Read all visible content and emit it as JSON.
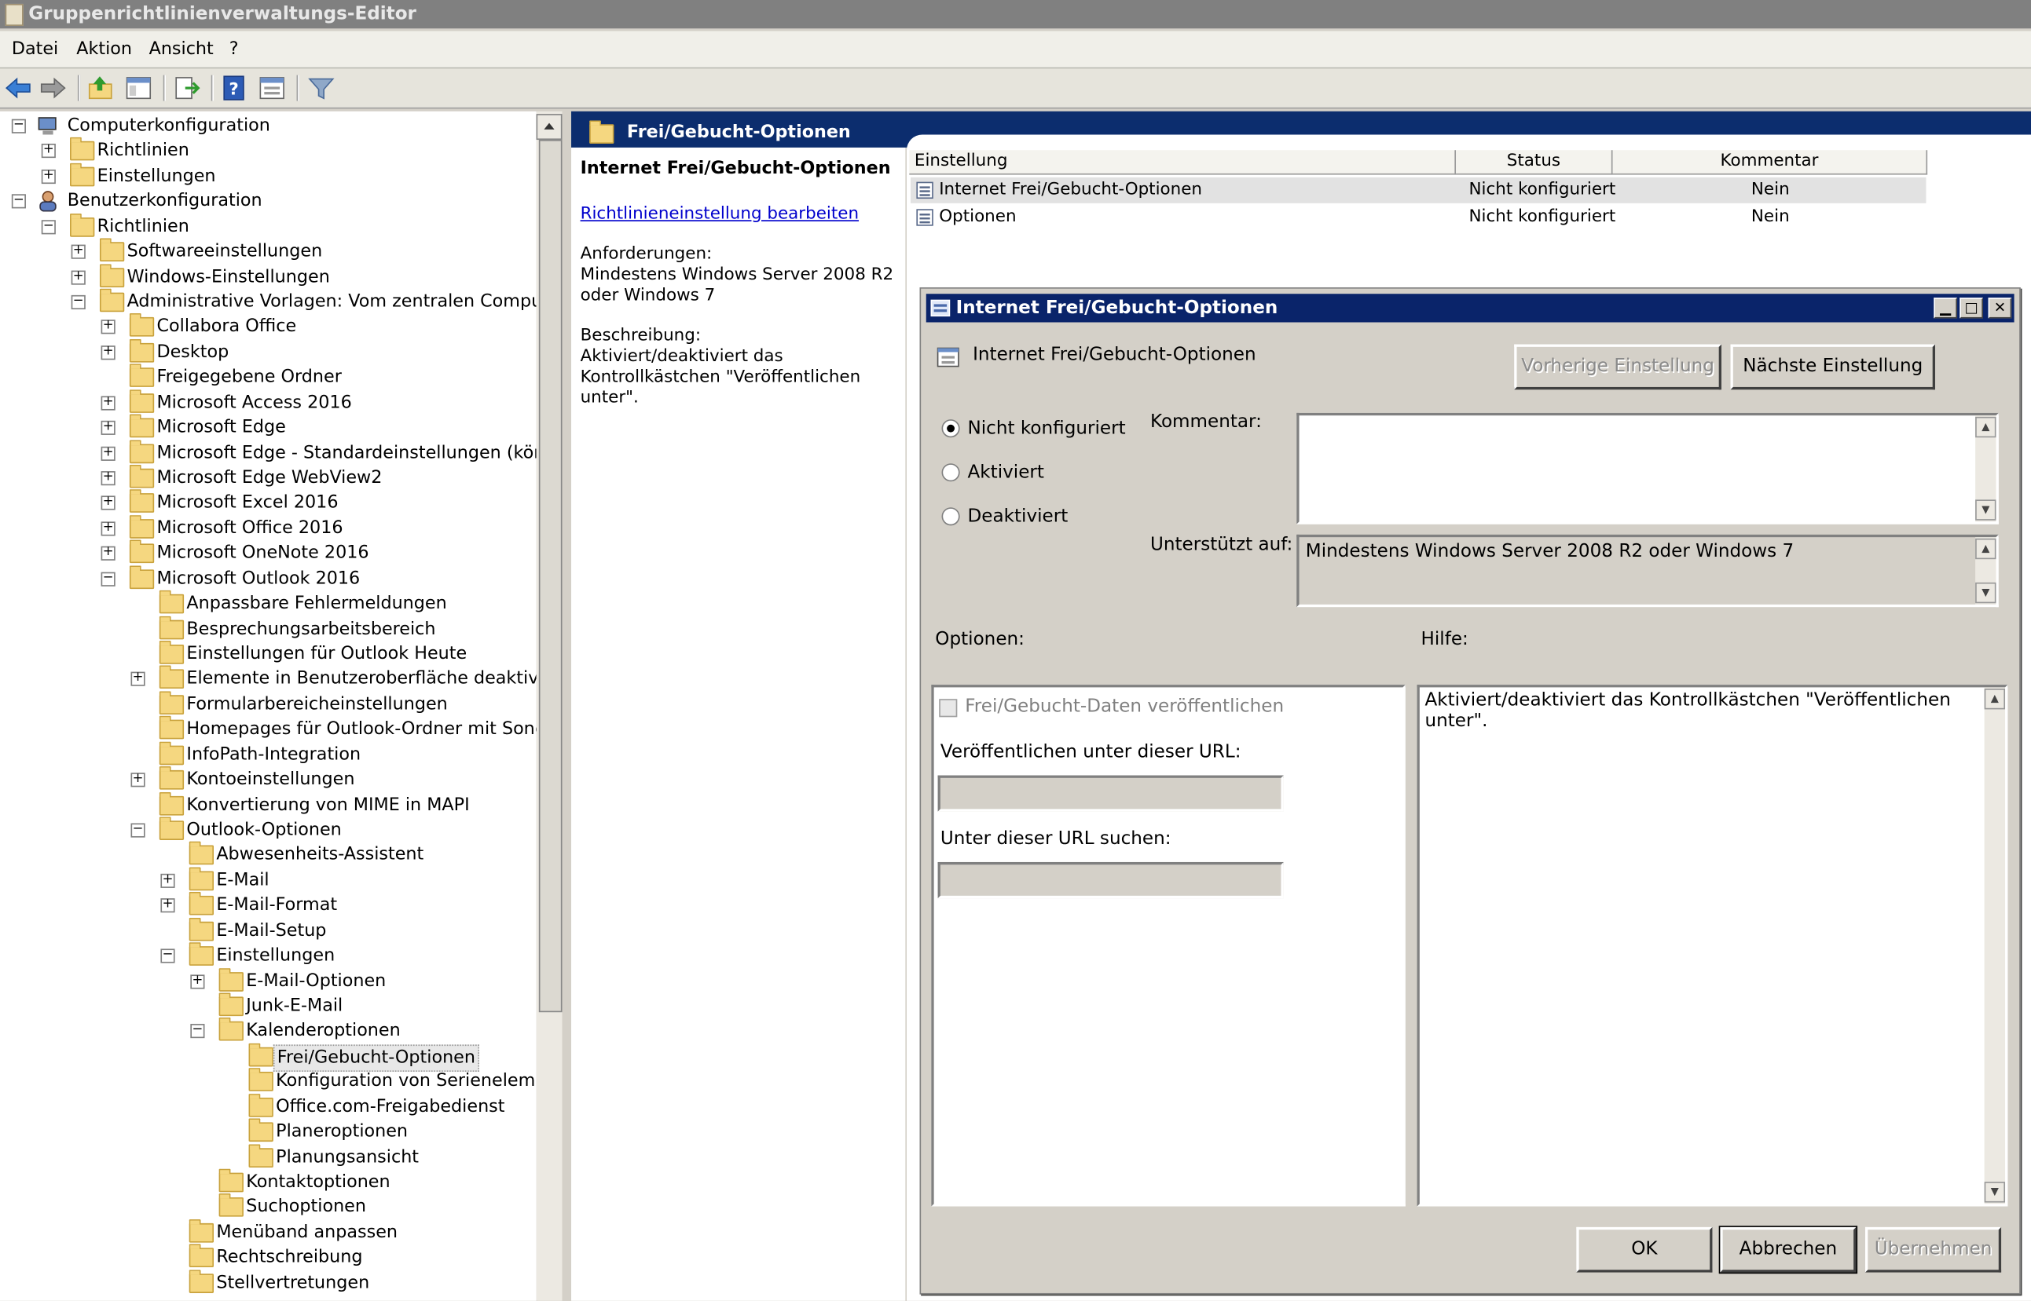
{
  "window": {
    "title": "Gruppenrichtlinienverwaltungs-Editor"
  },
  "menu": [
    "Datei",
    "Aktion",
    "Ansicht",
    "?"
  ],
  "toolbar": {
    "icons": [
      "back-arrow-icon",
      "forward-arrow-icon",
      "up-folder-icon",
      "show-tree-icon",
      "export-list-icon",
      "help-icon",
      "properties-icon",
      "filter-icon"
    ]
  },
  "tree": [
    {
      "label": "Computerkonfiguration",
      "level": 0,
      "exp": "-",
      "icon": "computer"
    },
    {
      "label": "Richtlinien",
      "level": 1,
      "exp": "+",
      "icon": "folder"
    },
    {
      "label": "Einstellungen",
      "level": 1,
      "exp": "+",
      "icon": "folder"
    },
    {
      "label": "Benutzerkonfiguration",
      "level": 0,
      "exp": "-",
      "icon": "user"
    },
    {
      "label": "Richtlinien",
      "level": 1,
      "exp": "-",
      "icon": "folder"
    },
    {
      "label": "Softwareeinstellungen",
      "level": 2,
      "exp": "+",
      "icon": "folder"
    },
    {
      "label": "Windows-Einstellungen",
      "level": 2,
      "exp": "+",
      "icon": "folder"
    },
    {
      "label": "Administrative Vorlagen: Vom zentralen Computer abg",
      "level": 2,
      "exp": "-",
      "icon": "folder"
    },
    {
      "label": "Collabora Office",
      "level": 3,
      "exp": "+",
      "icon": "folder"
    },
    {
      "label": "Desktop",
      "level": 3,
      "exp": "+",
      "icon": "folder"
    },
    {
      "label": "Freigegebene Ordner",
      "level": 3,
      "exp": "",
      "icon": "folder"
    },
    {
      "label": "Microsoft Access 2016",
      "level": 3,
      "exp": "+",
      "icon": "folder"
    },
    {
      "label": "Microsoft Edge",
      "level": 3,
      "exp": "+",
      "icon": "folder"
    },
    {
      "label": "Microsoft Edge - Standardeinstellungen (können du",
      "level": 3,
      "exp": "+",
      "icon": "folder"
    },
    {
      "label": "Microsoft Edge WebView2",
      "level": 3,
      "exp": "+",
      "icon": "folder"
    },
    {
      "label": "Microsoft Excel 2016",
      "level": 3,
      "exp": "+",
      "icon": "folder"
    },
    {
      "label": "Microsoft Office 2016",
      "level": 3,
      "exp": "+",
      "icon": "folder"
    },
    {
      "label": "Microsoft OneNote 2016",
      "level": 3,
      "exp": "+",
      "icon": "folder"
    },
    {
      "label": "Microsoft Outlook 2016",
      "level": 3,
      "exp": "-",
      "icon": "folder"
    },
    {
      "label": "Anpassbare Fehlermeldungen",
      "level": 4,
      "exp": "",
      "icon": "folder"
    },
    {
      "label": "Besprechungsarbeitsbereich",
      "level": 4,
      "exp": "",
      "icon": "folder"
    },
    {
      "label": "Einstellungen für Outlook Heute",
      "level": 4,
      "exp": "",
      "icon": "folder"
    },
    {
      "label": "Elemente in Benutzeroberfläche deaktivieren",
      "level": 4,
      "exp": "+",
      "icon": "folder"
    },
    {
      "label": "Formularbereicheinstellungen",
      "level": 4,
      "exp": "",
      "icon": "folder"
    },
    {
      "label": "Homepages für Outlook-Ordner mit Sonderfunl",
      "level": 4,
      "exp": "",
      "icon": "folder"
    },
    {
      "label": "InfoPath-Integration",
      "level": 4,
      "exp": "",
      "icon": "folder"
    },
    {
      "label": "Kontoeinstellungen",
      "level": 4,
      "exp": "+",
      "icon": "folder"
    },
    {
      "label": "Konvertierung von MIME in MAPI",
      "level": 4,
      "exp": "",
      "icon": "folder"
    },
    {
      "label": "Outlook-Optionen",
      "level": 4,
      "exp": "-",
      "icon": "folder"
    },
    {
      "label": "Abwesenheits-Assistent",
      "level": 5,
      "exp": "",
      "icon": "folder"
    },
    {
      "label": "E-Mail",
      "level": 5,
      "exp": "+",
      "icon": "folder"
    },
    {
      "label": "E-Mail-Format",
      "level": 5,
      "exp": "+",
      "icon": "folder"
    },
    {
      "label": "E-Mail-Setup",
      "level": 5,
      "exp": "",
      "icon": "folder"
    },
    {
      "label": "Einstellungen",
      "level": 5,
      "exp": "-",
      "icon": "folder"
    },
    {
      "label": "E-Mail-Optionen",
      "level": 6,
      "exp": "+",
      "icon": "folder"
    },
    {
      "label": "Junk-E-Mail",
      "level": 6,
      "exp": "",
      "icon": "folder"
    },
    {
      "label": "Kalenderoptionen",
      "level": 6,
      "exp": "-",
      "icon": "folder"
    },
    {
      "label": "Frei/Gebucht-Optionen",
      "level": 7,
      "exp": "",
      "icon": "folder",
      "selected": true
    },
    {
      "label": "Konfiguration von Serienelementen",
      "level": 7,
      "exp": "",
      "icon": "folder"
    },
    {
      "label": "Office.com-Freigabedienst",
      "level": 7,
      "exp": "",
      "icon": "folder"
    },
    {
      "label": "Planeroptionen",
      "level": 7,
      "exp": "",
      "icon": "folder"
    },
    {
      "label": "Planungsansicht",
      "level": 7,
      "exp": "",
      "icon": "folder"
    },
    {
      "label": "Kontaktoptionen",
      "level": 6,
      "exp": "",
      "icon": "folder"
    },
    {
      "label": "Suchoptionen",
      "level": 6,
      "exp": "",
      "icon": "folder"
    },
    {
      "label": "Menüband anpassen",
      "level": 5,
      "exp": "",
      "icon": "folder"
    },
    {
      "label": "Rechtschreibung",
      "level": 5,
      "exp": "",
      "icon": "folder"
    },
    {
      "label": "Stellvertretungen",
      "level": 5,
      "exp": "",
      "icon": "folder"
    }
  ],
  "right_header": {
    "title": "Frei/Gebucht-Optionen"
  },
  "description": {
    "title": "Internet Frei/Gebucht-Optionen",
    "edit_link": "Richtlinieneinstellung bearbeiten",
    "req_label": "Anforderungen:",
    "req_1": "Mindestens Windows Server 2008 R2",
    "req_2": "oder Windows 7",
    "desc_label": "Beschreibung:",
    "desc_1": "Aktiviert/deaktiviert das",
    "desc_2": "Kontrollkästchen \"Veröffentlichen unter\"."
  },
  "list": {
    "columns": [
      "Einstellung",
      "Status",
      "Kommentar"
    ],
    "rows": [
      {
        "setting": "Internet Frei/Gebucht-Optionen",
        "status": "Nicht konfiguriert",
        "comment": "Nein"
      },
      {
        "setting": "Optionen",
        "status": "Nicht konfiguriert",
        "comment": "Nein"
      }
    ]
  },
  "dialog": {
    "title": "Internet Frei/Gebucht-Optionen",
    "setting_name": "Internet Frei/Gebucht-Optionen",
    "prev_button": "Vorherige Einstellung",
    "next_button": "Nächste Einstellung",
    "radio_not_configured": "Nicht konfiguriert",
    "radio_enabled": "Aktiviert",
    "radio_disabled": "Deaktiviert",
    "selected_radio": "Nicht konfiguriert",
    "comment_label": "Kommentar:",
    "comment_value": "",
    "supported_label": "Unterstützt auf:",
    "supported_value": "Mindestens Windows Server 2008 R2 oder Windows 7",
    "options_label": "Optionen:",
    "help_label": "Hilfe:",
    "checkbox_label": "Frei/Gebucht-Daten veröffentlichen",
    "publish_url_label": "Veröffentlichen unter dieser URL:",
    "publish_url_value": "",
    "search_url_label": "Unter dieser URL suchen:",
    "search_url_value": "",
    "help_text": "Aktiviert/deaktiviert das Kontrollkästchen \"Veröffentlichen unter\".",
    "ok": "OK",
    "cancel": "Abbrechen",
    "apply": "Übernehmen"
  },
  "colors": {
    "header_band": "#0c2d6e",
    "dialog_title": "#0a246a",
    "link": "#0000cc",
    "folder": "#f5d780"
  }
}
